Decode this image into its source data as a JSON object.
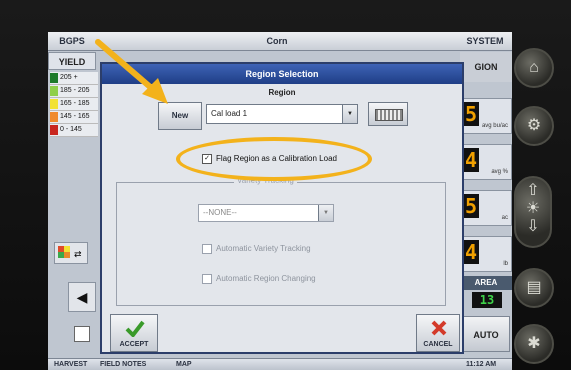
{
  "top_bar": {
    "left": "BGPS",
    "center": "Corn",
    "right": "SYSTEM"
  },
  "left_panel": {
    "header": "YIELD",
    "legend": [
      {
        "label": "205 +",
        "color": "#1d7a2a"
      },
      {
        "label": "185 - 205",
        "color": "#8fcf4a"
      },
      {
        "label": "165 - 185",
        "color": "#f2e233"
      },
      {
        "label": "145 - 165",
        "color": "#f08a2b"
      },
      {
        "label": "0 - 145",
        "color": "#c8261e"
      }
    ],
    "arrow": "◀"
  },
  "right_panel": {
    "header": "GION",
    "readouts": [
      {
        "value": "5",
        "unit": "avg bu/ac"
      },
      {
        "value": "4",
        "unit": "avg %"
      },
      {
        "value": "5",
        "unit": "ac"
      },
      {
        "value": "4",
        "unit": "lb"
      }
    ],
    "area_label": "AREA",
    "area_value": "13",
    "auto_label": "AUTO"
  },
  "bottom_bar": {
    "tab1": "HARVEST",
    "tab2": "FIELD NOTES",
    "tab3": "MAP",
    "clock": "11:12 AM"
  },
  "dialog": {
    "title": "Region Selection",
    "region_label": "Region",
    "new_label": "New",
    "region_value": "Cal load 1",
    "flag_label": "Flag Region as a Calibration Load",
    "flag_checked": "✓",
    "variety_label": "Variety Tracking",
    "variety_value": "--NONE--",
    "auto_variety_label": "Automatic Variety Tracking",
    "auto_region_label": "Automatic Region Changing",
    "accept_label": "ACCEPT",
    "cancel_label": "CANCEL"
  },
  "hardware": {
    "icons": [
      "home-icon",
      "settings-icon",
      "brightness-icon",
      "notes-icon",
      "runner-icon"
    ]
  },
  "annotation_color": "#f3b21b"
}
